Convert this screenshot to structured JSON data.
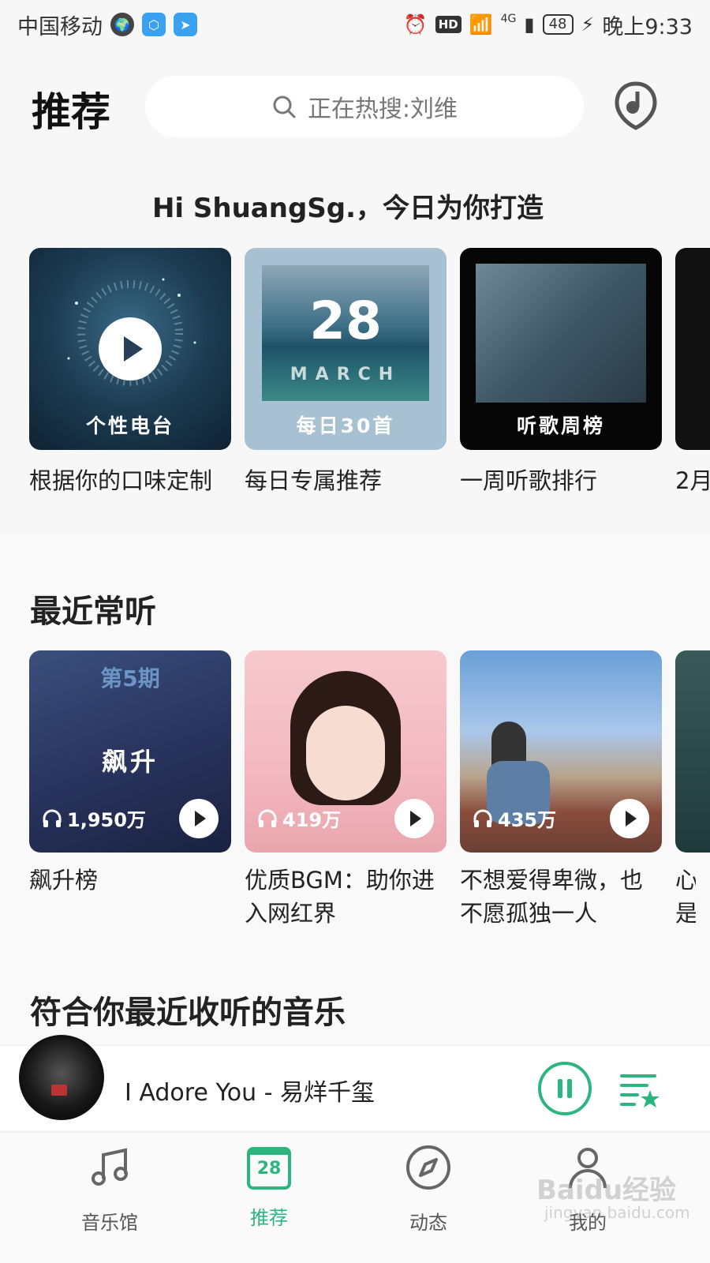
{
  "status_bar": {
    "carrier": "中国移动",
    "network": "4G",
    "battery": "48",
    "time": "晚上9:33",
    "hd_label": "HD"
  },
  "header": {
    "title": "推荐",
    "search_placeholder": "正在热搜:刘维"
  },
  "greeting": "Hi ShuangSg.，今日为你打造",
  "daily": [
    {
      "cover_label": "个性电台",
      "title": "根据你的口味定制"
    },
    {
      "cover_label": "每日30首",
      "cover_day": "28",
      "cover_month": "MARCH",
      "title": "每日专属推荐"
    },
    {
      "cover_label": "听歌周榜",
      "title": "一周听歌排行"
    },
    {
      "title": "2月"
    }
  ],
  "recent": {
    "section_title": "最近常听",
    "items": [
      {
        "title": "飙升榜",
        "count": "1,950万",
        "cover_text": "飙升",
        "cover_badge": "第5期"
      },
      {
        "title": "优质BGM：助你进入网红界",
        "count": "419万"
      },
      {
        "title": "不想爱得卑微，也不愿孤独一人",
        "count": "435万"
      },
      {
        "title": "心是"
      }
    ]
  },
  "section3_title": "符合你最近收听的音乐",
  "now_playing": {
    "title": "I Adore You - 易烊千玺"
  },
  "tabs": [
    {
      "label": "音乐馆",
      "icon": "music-note-icon"
    },
    {
      "label": "推荐",
      "icon": "calendar-icon",
      "day": "28",
      "active": true
    },
    {
      "label": "动态",
      "icon": "compass-icon"
    },
    {
      "label": "我的",
      "icon": "person-icon"
    }
  ],
  "watermark": "Baidu经验",
  "watermark_url": "jingyan.baidu.com",
  "colors": {
    "accent": "#2bb680"
  }
}
